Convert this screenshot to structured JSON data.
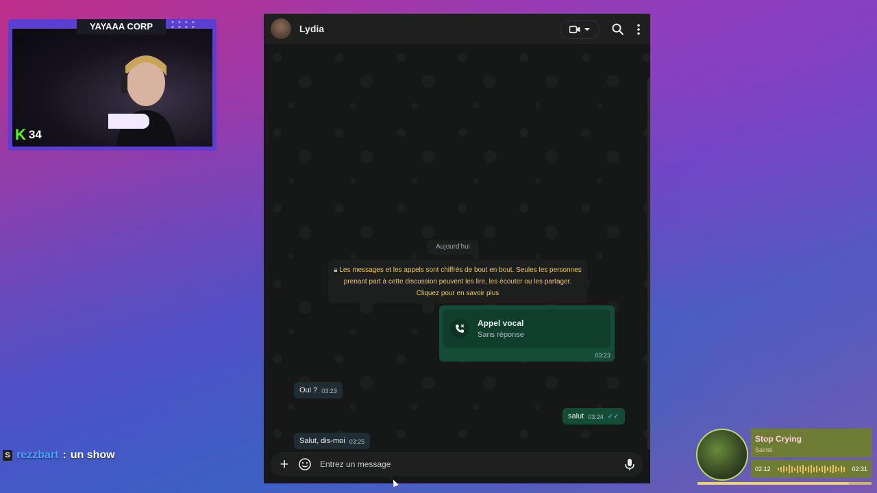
{
  "webcam": {
    "banner": "YAYAAA CORP",
    "score": "34",
    "k_badge": "K"
  },
  "chat_overlay": {
    "badge": "S",
    "user": "rezzbart",
    "separator": ":",
    "message": "un show"
  },
  "whatsapp": {
    "contact_name": "Lydia",
    "date_chip": "Aujourd'hui",
    "encryption_notice": "Les messages et les appels sont chiffrés de bout en bout. Seules les personnes prenant part à cette discussion peuvent les lire, les écouter ou les partager.",
    "encryption_link": "Cliquez pour en savoir plus",
    "call": {
      "title": "Appel vocal",
      "subtitle": "Sans réponse",
      "time": "03:23"
    },
    "messages": [
      {
        "direction": "in",
        "text": "Oui ?",
        "time": "03:23"
      },
      {
        "direction": "out",
        "text": "salut",
        "time": "03:24"
      },
      {
        "direction": "in",
        "text": "Salut, dis-moi",
        "time": "03:25"
      }
    ],
    "composer": {
      "placeholder": "Entrez un message"
    }
  },
  "music": {
    "title": "Stop Crying",
    "artist": "Sainté",
    "elapsed": "02:12",
    "duration": "02:31",
    "progress": 0.87
  },
  "colors": {
    "wa_out": "#144d37",
    "wa_in": "#202c33",
    "notice_text": "#f0c862",
    "music_panel": "#6f7c34"
  }
}
